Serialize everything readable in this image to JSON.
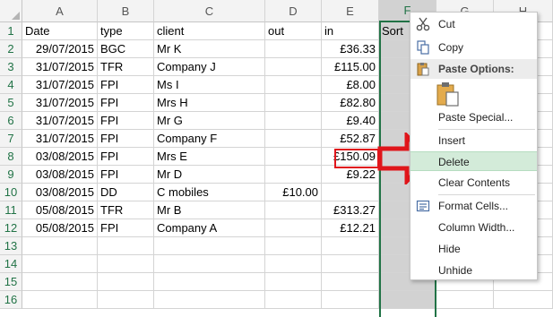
{
  "columns": [
    "A",
    "B",
    "C",
    "D",
    "E",
    "F",
    "G",
    "H"
  ],
  "rows": [
    "1",
    "2",
    "3",
    "4",
    "5",
    "6",
    "7",
    "8",
    "9",
    "10",
    "11",
    "12",
    "13",
    "14",
    "15",
    "16"
  ],
  "table": [
    [
      "Date",
      "type",
      "client",
      "out",
      "in",
      "Sort"
    ],
    [
      "29/07/2015",
      "BGC",
      "Mr K",
      "",
      "£36.33",
      ""
    ],
    [
      "31/07/2015",
      "TFR",
      "Company J",
      "",
      "£115.00",
      ""
    ],
    [
      "31/07/2015",
      "FPI",
      "Ms I",
      "",
      "£8.00",
      ""
    ],
    [
      "31/07/2015",
      "FPI",
      "Mrs H",
      "",
      "£82.80",
      ""
    ],
    [
      "31/07/2015",
      "FPI",
      "Mr G",
      "",
      "£9.40",
      ""
    ],
    [
      "31/07/2015",
      "FPI",
      "Company F",
      "",
      "£52.87",
      ""
    ],
    [
      "03/08/2015",
      "FPI",
      "Mrs E",
      "",
      "£150.09",
      ""
    ],
    [
      "03/08/2015",
      "FPI",
      "Mr D",
      "",
      "£9.22",
      ""
    ],
    [
      "03/08/2015",
      "DD",
      "C mobiles",
      "£10.00",
      "",
      ""
    ],
    [
      "05/08/2015",
      "TFR",
      "Mr B",
      "",
      "£313.27",
      ""
    ],
    [
      "05/08/2015",
      "FPI",
      "Company A",
      "",
      "£12.21",
      ""
    ]
  ],
  "context_menu": {
    "cut": "Cut",
    "copy": "Copy",
    "paste_options": "Paste Options:",
    "paste_special": "Paste Special...",
    "insert": "Insert",
    "delete": "Delete",
    "clear_contents": "Clear Contents",
    "format_cells": "Format Cells...",
    "column_width": "Column Width...",
    "hide": "Hide",
    "unhide": "Unhide",
    "icons": [
      "scissors-icon",
      "copy-icon",
      "paste-icon",
      "paste-values-icon",
      "format-cells-icon"
    ]
  },
  "colors": {
    "selection": "#217346",
    "highlight_box": "#e0151b",
    "menu_hover": "#d3ebd9"
  }
}
